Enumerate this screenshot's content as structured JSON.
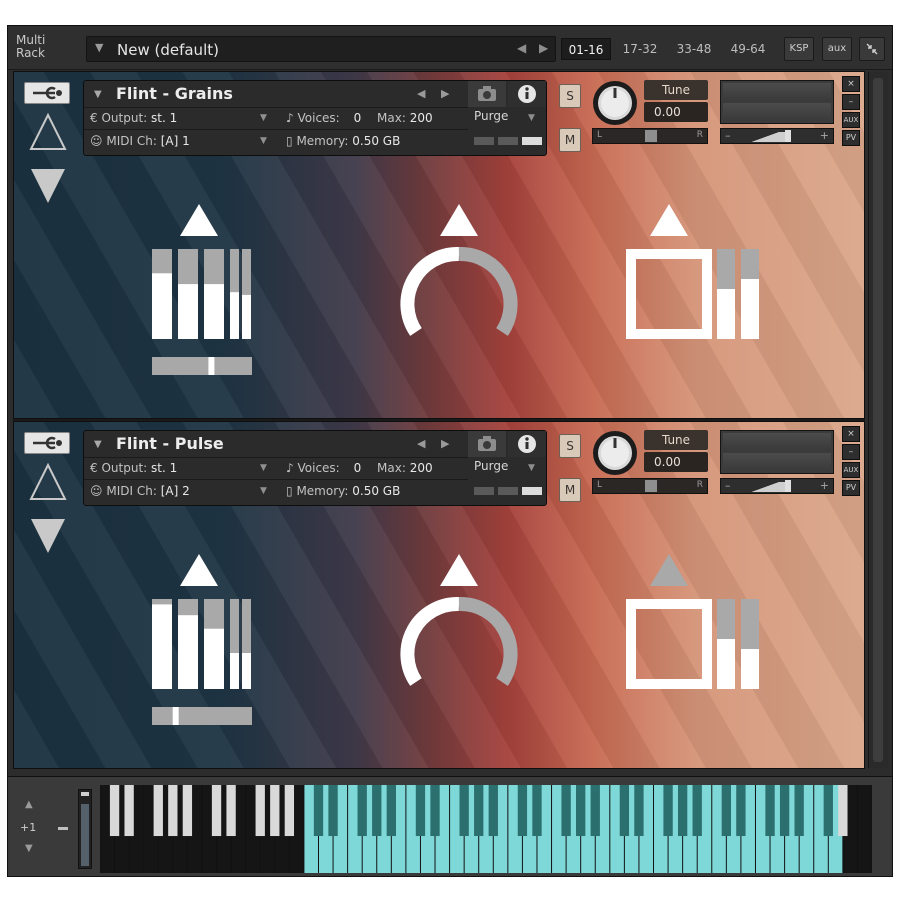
{
  "header": {
    "rack_label": "Multi Rack",
    "multi_name": "New (default)",
    "pages": [
      {
        "label": "01-16",
        "active": true
      },
      {
        "label": "17-32",
        "active": false
      },
      {
        "label": "33-48",
        "active": false
      },
      {
        "label": "49-64",
        "active": false
      }
    ],
    "ksp_label": "KSP",
    "aux_label": "aux"
  },
  "instruments": [
    {
      "name": "Flint - Grains",
      "output_label": "Output:",
      "output_value": "st. 1",
      "midi_label": "MIDI Ch:",
      "midi_value": "[A]  1",
      "voices_label": "Voices:",
      "voices_value": "0",
      "max_label": "Max:",
      "max_value": "200",
      "memory_label": "Memory:",
      "memory_value": "0.50 GB",
      "purge_label": "Purge",
      "solo_label": "S",
      "mute_label": "M",
      "tune_label": "Tune",
      "tune_value": "0.00",
      "pan_left": "L",
      "pan_right": "R",
      "side_close": "×",
      "side_min": "–",
      "side_aux": "AUX",
      "side_pv": "PV",
      "faders": [
        0.55,
        0.35,
        0.35,
        0.2,
        0.15
      ],
      "slider_position": 0.6,
      "knob_arc_fraction": 0.5,
      "knob_triangle_gray": false,
      "meter_fill": [
        0.3,
        0.6
      ],
      "square_triangle_gray": false
    },
    {
      "name": "Flint - Pulse",
      "output_label": "Output:",
      "output_value": "st. 1",
      "midi_label": "MIDI Ch:",
      "midi_value": "[A]  2",
      "voices_label": "Voices:",
      "voices_value": "0",
      "max_label": "Max:",
      "max_value": "200",
      "memory_label": "Memory:",
      "memory_value": "0.50 GB",
      "purge_label": "Purge",
      "solo_label": "S",
      "mute_label": "M",
      "tune_label": "Tune",
      "tune_value": "0.00",
      "pan_left": "L",
      "pan_right": "R",
      "side_close": "×",
      "side_min": "–",
      "side_aux": "AUX",
      "side_pv": "PV",
      "faders": [
        0.9,
        0.7,
        0.45,
        0.0,
        0.0
      ],
      "slider_position": 0.22,
      "knob_arc_fraction": 0.5,
      "knob_triangle_gray": false,
      "meter_fill": [
        0.45,
        0.55
      ],
      "square_triangle_gray": true
    }
  ],
  "keyboard": {
    "octave_value": "+1",
    "highlight_start_white": 14,
    "highlight_end_white": 50,
    "white_key_count": 53,
    "mod_wheel_level": 0.82
  },
  "colors": {
    "accent": "#7fd8d8",
    "panel": "#2b2b2b",
    "gray_shape": "#a9a9a9"
  }
}
